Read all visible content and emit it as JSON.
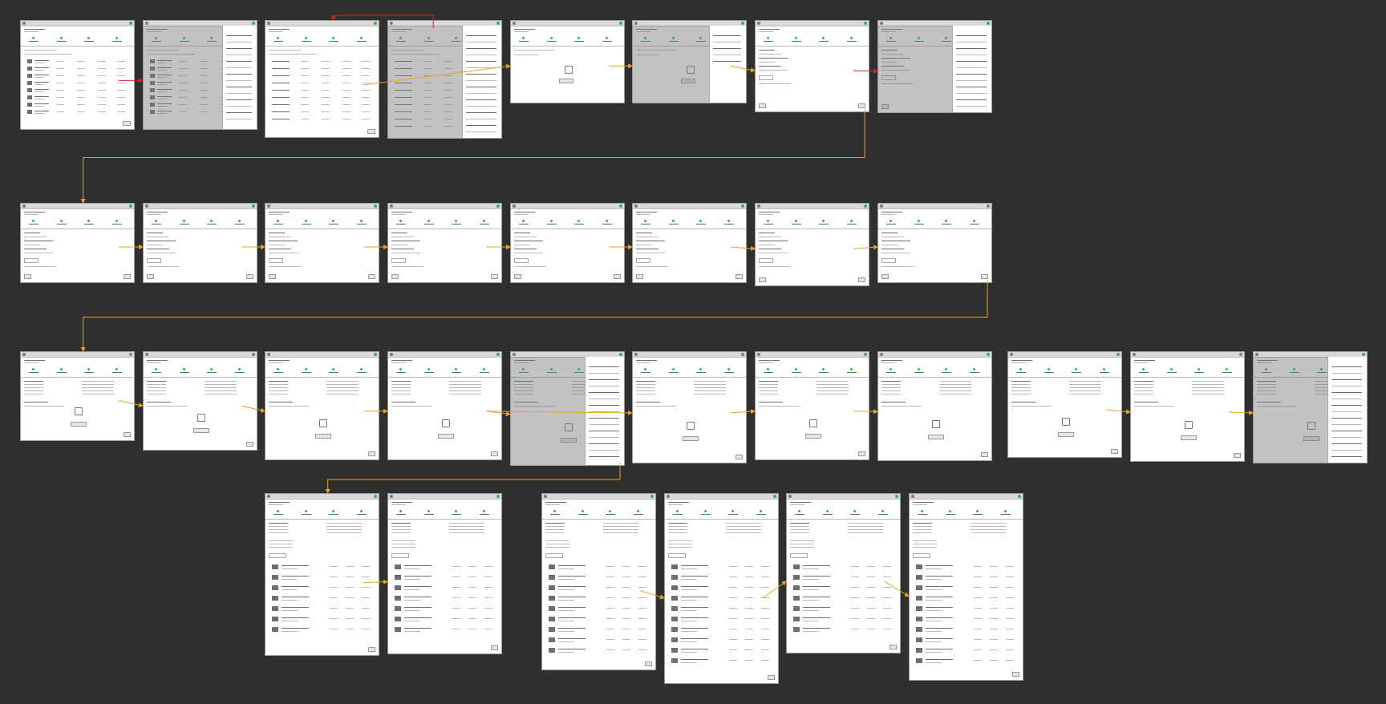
{
  "canvas": {
    "background": "#2f2f2f",
    "note": ""
  },
  "colors": {
    "screen_bg": "#ffffff",
    "accent_green": "#3fae5b",
    "flow_orange": "#e5a425",
    "flow_red": "#d6232a",
    "overlay_grey": "#8a8a8a"
  },
  "screens": [
    {
      "id": "r1s1",
      "kind": "list",
      "overlay": false
    },
    {
      "id": "r1s2",
      "kind": "list",
      "overlay": true,
      "panel": "filter"
    },
    {
      "id": "r1s3",
      "kind": "table",
      "overlay": false
    },
    {
      "id": "r1s4",
      "kind": "table",
      "overlay": true,
      "panel": "list"
    },
    {
      "id": "r1s5",
      "kind": "empty",
      "overlay": false
    },
    {
      "id": "r1s6",
      "kind": "empty",
      "overlay": true,
      "panel": "small"
    },
    {
      "id": "r1s7",
      "kind": "form",
      "overlay": false
    },
    {
      "id": "r1s8",
      "kind": "form",
      "overlay": true,
      "panel": "list"
    },
    {
      "id": "r2s1",
      "kind": "form",
      "overlay": false
    },
    {
      "id": "r2s2",
      "kind": "form",
      "overlay": false
    },
    {
      "id": "r2s3",
      "kind": "form",
      "overlay": false
    },
    {
      "id": "r2s4",
      "kind": "form",
      "overlay": false
    },
    {
      "id": "r2s5",
      "kind": "form",
      "overlay": false
    },
    {
      "id": "r2s6",
      "kind": "form",
      "overlay": false
    },
    {
      "id": "r2s7",
      "kind": "form",
      "overlay": false
    },
    {
      "id": "r2s8",
      "kind": "form",
      "overlay": false
    },
    {
      "id": "r3s1",
      "kind": "detail",
      "overlay": false
    },
    {
      "id": "r3s2",
      "kind": "detail",
      "overlay": false
    },
    {
      "id": "r3s3",
      "kind": "detail",
      "overlay": false
    },
    {
      "id": "r3s4",
      "kind": "detail",
      "overlay": false
    },
    {
      "id": "r3s5",
      "kind": "detail",
      "overlay": true,
      "panel": "list"
    },
    {
      "id": "r3s6",
      "kind": "detail",
      "overlay": false
    },
    {
      "id": "r3s7",
      "kind": "detail",
      "overlay": false
    },
    {
      "id": "r3s8",
      "kind": "detail",
      "overlay": false
    },
    {
      "id": "r3s9",
      "kind": "detail",
      "overlay": false
    },
    {
      "id": "r3s10",
      "kind": "detail",
      "overlay": false
    },
    {
      "id": "r3s11",
      "kind": "detail",
      "overlay": true,
      "panel": "list"
    },
    {
      "id": "r4s1",
      "kind": "long",
      "overlay": false
    },
    {
      "id": "r4s2",
      "kind": "long",
      "overlay": false
    },
    {
      "id": "r4s3",
      "kind": "long",
      "overlay": false
    },
    {
      "id": "r4s4",
      "kind": "long",
      "overlay": false
    },
    {
      "id": "r4s5",
      "kind": "long",
      "overlay": false
    },
    {
      "id": "r4s6",
      "kind": "long",
      "overlay": false
    }
  ],
  "flows": [
    {
      "from": "r1s1",
      "to": "r1s2",
      "color": "red"
    },
    {
      "from": "r1s3",
      "to": "r1s5",
      "color": "orange"
    },
    {
      "from": "r1s4",
      "to": "r1s3",
      "color": "red"
    },
    {
      "from": "r1s5",
      "to": "r1s6",
      "color": "orange"
    },
    {
      "from": "r1s6",
      "to": "r1s7",
      "color": "orange"
    },
    {
      "from": "r1s7",
      "to": "r1s8",
      "color": "red"
    },
    {
      "from": "r1s7",
      "to": "r2s1",
      "color": "orange"
    },
    {
      "from": "r2s1",
      "to": "r2s2",
      "color": "orange"
    },
    {
      "from": "r2s2",
      "to": "r2s3",
      "color": "orange"
    },
    {
      "from": "r2s3",
      "to": "r2s4",
      "color": "orange"
    },
    {
      "from": "r2s4",
      "to": "r2s5",
      "color": "orange"
    },
    {
      "from": "r2s5",
      "to": "r2s6",
      "color": "orange"
    },
    {
      "from": "r2s6",
      "to": "r2s7",
      "color": "orange"
    },
    {
      "from": "r2s7",
      "to": "r2s8",
      "color": "orange"
    },
    {
      "from": "r2s8",
      "to": "r3s1",
      "color": "orange"
    },
    {
      "from": "r3s1",
      "to": "r3s2",
      "color": "orange"
    },
    {
      "from": "r3s2",
      "to": "r3s3",
      "color": "orange"
    },
    {
      "from": "r3s3",
      "to": "r3s4",
      "color": "orange"
    },
    {
      "from": "r3s4",
      "to": "r3s5",
      "color": "orange"
    },
    {
      "from": "r3s4",
      "to": "r3s6",
      "color": "orange"
    },
    {
      "from": "r3s6",
      "to": "r3s7",
      "color": "orange"
    },
    {
      "from": "r3s7",
      "to": "r3s8",
      "color": "orange"
    },
    {
      "from": "r3s9",
      "to": "r3s10",
      "color": "orange"
    },
    {
      "from": "r3s10",
      "to": "r3s11",
      "color": "orange"
    },
    {
      "from": "r3s5",
      "to": "r4s1",
      "color": "orange"
    },
    {
      "from": "r4s1",
      "to": "r4s2",
      "color": "orange"
    },
    {
      "from": "r4s3",
      "to": "r4s4",
      "color": "orange"
    },
    {
      "from": "r4s4",
      "to": "r4s5",
      "color": "orange"
    },
    {
      "from": "r4s5",
      "to": "r4s6",
      "color": "orange"
    }
  ]
}
